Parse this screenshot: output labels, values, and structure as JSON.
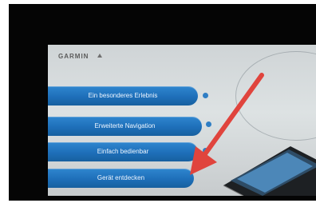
{
  "app": {
    "brand": "GARMIN"
  },
  "menu": {
    "items": [
      {
        "label": "Ein besonderes Erlebnis"
      },
      {
        "label": "Erweiterte Navigation"
      },
      {
        "label": "Einfach bedienbar"
      },
      {
        "label": "Gerät entdecken"
      }
    ]
  },
  "colors": {
    "button_blue": "#1e6fb9",
    "arrow_red": "#e0443d",
    "screen_bg": "#dde2e3",
    "bezel": "#050505"
  },
  "icons": {
    "info": "info-icon",
    "menu": "round-menu-button",
    "arrow": "red-annotation-arrow"
  }
}
